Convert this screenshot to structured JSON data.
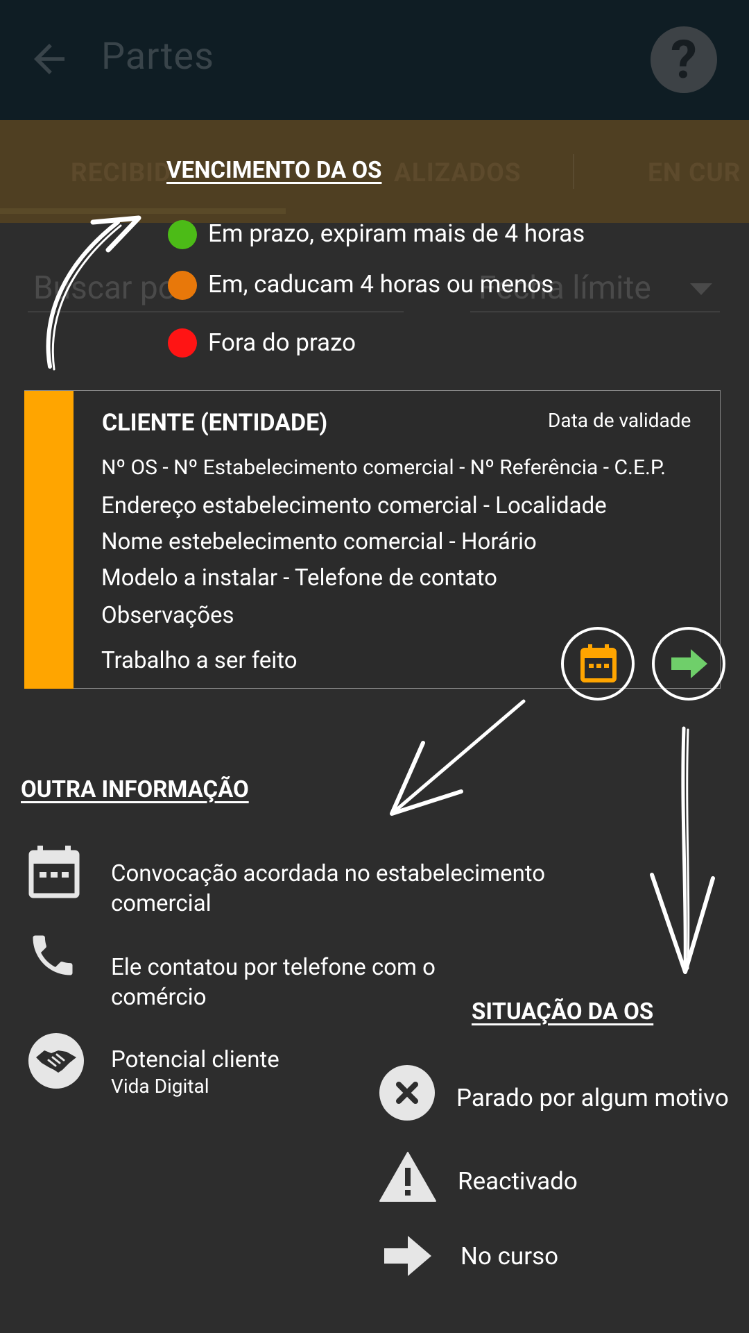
{
  "app_bar": {
    "title": "Partes"
  },
  "tabs": [
    {
      "label": "RECIBID"
    },
    {
      "label": "ALIZADOS"
    },
    {
      "label": "EN CUR"
    }
  ],
  "filters": {
    "search_placeholder": "Buscar po",
    "date_label": "Fecha límite"
  },
  "legend": {
    "heading": "VENCIMENTO DA OS",
    "items": [
      {
        "label": "Em prazo, expiram mais de 4 horas",
        "color": "#4cbb17"
      },
      {
        "label": "Em, caducam 4 horas ou menos",
        "color": "#e8780a"
      },
      {
        "label": "Fora do prazo",
        "color": "#ff1414"
      }
    ]
  },
  "card": {
    "client": "CLIENTE (ENTIDADE)",
    "date": "Data de validade",
    "line1": "Nº OS - Nº Estabelecimento comercial - Nº Referência - C.E.P.",
    "line2": "Endereço estabelecimento comercial - Localidade",
    "line3": "Nome estebelecimento comercial - Horário",
    "line4": "Modelo a instalar - Telefone de contato",
    "line5": "Observações",
    "line6": "Trabalho a ser feito",
    "stripe_color": "#ffa500"
  },
  "other_info": {
    "heading": "OUTRA INFORMAÇÃO",
    "items": [
      {
        "icon": "calendar-icon",
        "text": "Convocação acordada no estabelecimento comercial"
      },
      {
        "icon": "phone-icon",
        "text": "Ele contatou por telefone com o comércio"
      },
      {
        "icon": "handshake-icon",
        "text": "Potencial cliente",
        "subtext": "Vida Digital"
      }
    ]
  },
  "status": {
    "heading": "SITUAÇÃO DA OS",
    "items": [
      {
        "icon": "close-circle-icon",
        "label": "Parado por algum motivo"
      },
      {
        "icon": "warning-icon",
        "label": "Reactivado"
      },
      {
        "icon": "arrow-right-icon",
        "label": "No curso"
      }
    ]
  }
}
